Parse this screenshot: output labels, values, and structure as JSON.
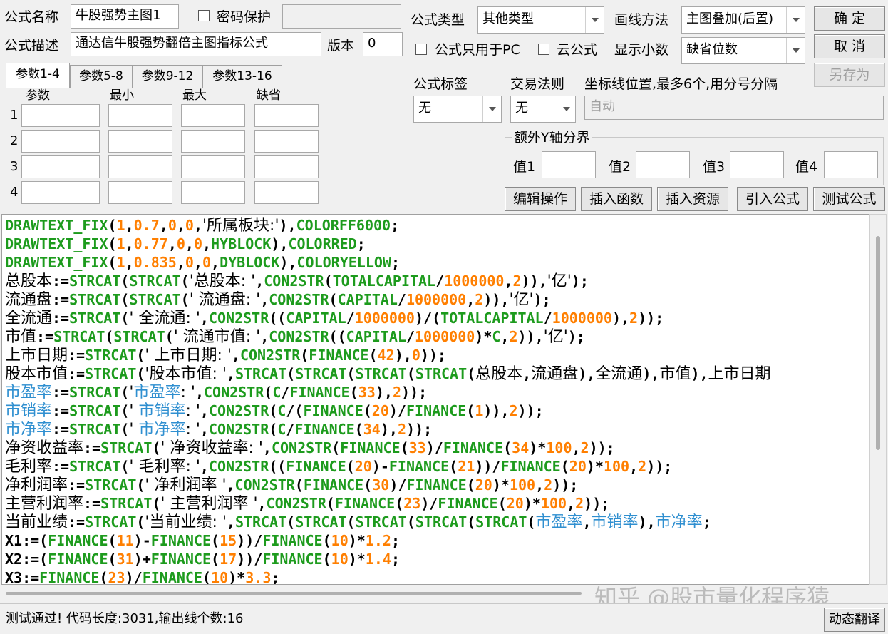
{
  "form": {
    "name_label": "公式名称",
    "name_value": "牛股强势主图1",
    "password_label": "密码保护",
    "desc_label": "公式描述",
    "desc_value": "通达信牛股强势翻倍主图指标公式",
    "version_label": "版本",
    "version_value": "0",
    "type_label": "公式类型",
    "type_value": "其他类型",
    "draw_label": "画线方法",
    "draw_value": "主图叠加(后置)",
    "pc_only_label": "公式只用于PC",
    "cloud_label": "云公式",
    "decimals_label": "显示小数",
    "decimals_value": "缺省位数",
    "tag_label": "公式标签",
    "tag_value": "无",
    "trade_label": "交易法则",
    "trade_value": "无",
    "axis_label": "坐标线位置,最多6个,用分号分隔",
    "axis_placeholder": "自动",
    "yaxis_group_label": "额外Y轴分界",
    "y1_label": "值1",
    "y2_label": "值2",
    "y3_label": "值3",
    "y4_label": "值4"
  },
  "buttons": {
    "ok": "确  定",
    "cancel": "取  消",
    "save_as": "另存为",
    "edit": "编辑操作",
    "insert_func": "插入函数",
    "insert_res": "插入资源",
    "import": "引入公式",
    "test": "测试公式",
    "translate": "动态翻译"
  },
  "params": {
    "tabs": [
      "参数1-4",
      "参数5-8",
      "参数9-12",
      "参数13-16"
    ],
    "headers": [
      "参数",
      "最小",
      "最大",
      "缺省"
    ],
    "rows": [
      "1",
      "2",
      "3",
      "4"
    ]
  },
  "code_lines": [
    [
      [
        "f",
        "DRAWTEXT_FIX"
      ],
      [
        "p",
        "("
      ],
      [
        "n",
        "1"
      ],
      [
        "p",
        ","
      ],
      [
        "n",
        "0.7"
      ],
      [
        "p",
        ","
      ],
      [
        "n",
        "0"
      ],
      [
        "p",
        ","
      ],
      [
        "n",
        "0"
      ],
      [
        "p",
        ","
      ],
      [
        "s",
        "'所属板块:'"
      ],
      [
        "p",
        "),"
      ],
      [
        "f",
        "COLORFF6000"
      ],
      [
        "p",
        ";"
      ]
    ],
    [
      [
        "f",
        "DRAWTEXT_FIX"
      ],
      [
        "p",
        "("
      ],
      [
        "n",
        "1"
      ],
      [
        "p",
        ","
      ],
      [
        "n",
        "0.77"
      ],
      [
        "p",
        ","
      ],
      [
        "n",
        "0"
      ],
      [
        "p",
        ","
      ],
      [
        "n",
        "0"
      ],
      [
        "p",
        ","
      ],
      [
        "f",
        "HYBLOCK"
      ],
      [
        "p",
        "),"
      ],
      [
        "f",
        "COLORRED"
      ],
      [
        "p",
        ";"
      ]
    ],
    [
      [
        "f",
        "DRAWTEXT_FIX"
      ],
      [
        "p",
        "("
      ],
      [
        "n",
        "1"
      ],
      [
        "p",
        ","
      ],
      [
        "n",
        "0.835"
      ],
      [
        "p",
        ","
      ],
      [
        "n",
        "0"
      ],
      [
        "p",
        ","
      ],
      [
        "n",
        "0"
      ],
      [
        "p",
        ","
      ],
      [
        "f",
        "DYBLOCK"
      ],
      [
        "p",
        "),"
      ],
      [
        "f",
        "COLORYELLOW"
      ],
      [
        "p",
        ";"
      ]
    ],
    [
      [
        "v",
        "总股本"
      ],
      [
        "p",
        ":="
      ],
      [
        "f",
        "STRCAT"
      ],
      [
        "p",
        "("
      ],
      [
        "f",
        "STRCAT"
      ],
      [
        "p",
        "("
      ],
      [
        "s",
        "'总股本: '"
      ],
      [
        "p",
        ","
      ],
      [
        "f",
        "CON2STR"
      ],
      [
        "p",
        "("
      ],
      [
        "f",
        "TOTALCAPITAL"
      ],
      [
        "p",
        "/"
      ],
      [
        "n",
        "1000000"
      ],
      [
        "p",
        ","
      ],
      [
        "n",
        "2"
      ],
      [
        "p",
        ")),"
      ],
      [
        "s",
        "'亿'"
      ],
      [
        "p",
        ");"
      ]
    ],
    [
      [
        "v",
        "流通盘"
      ],
      [
        "p",
        ":="
      ],
      [
        "f",
        "STRCAT"
      ],
      [
        "p",
        "("
      ],
      [
        "f",
        "STRCAT"
      ],
      [
        "p",
        "("
      ],
      [
        "s",
        "' 流通盘: '"
      ],
      [
        "p",
        ","
      ],
      [
        "f",
        "CON2STR"
      ],
      [
        "p",
        "("
      ],
      [
        "f",
        "CAPITAL"
      ],
      [
        "p",
        "/"
      ],
      [
        "n",
        "1000000"
      ],
      [
        "p",
        ","
      ],
      [
        "n",
        "2"
      ],
      [
        "p",
        ")),"
      ],
      [
        "s",
        "'亿'"
      ],
      [
        "p",
        ");"
      ]
    ],
    [
      [
        "v",
        "全流通"
      ],
      [
        "p",
        ":="
      ],
      [
        "f",
        "STRCAT"
      ],
      [
        "p",
        "("
      ],
      [
        "s",
        "' 全流通: '"
      ],
      [
        "p",
        ","
      ],
      [
        "f",
        "CON2STR"
      ],
      [
        "p",
        "(("
      ],
      [
        "f",
        "CAPITAL"
      ],
      [
        "p",
        "/"
      ],
      [
        "n",
        "1000000"
      ],
      [
        "p",
        ")/("
      ],
      [
        "f",
        "TOTALCAPITAL"
      ],
      [
        "p",
        "/"
      ],
      [
        "n",
        "1000000"
      ],
      [
        "p",
        "),"
      ],
      [
        "n",
        "2"
      ],
      [
        "p",
        "));"
      ]
    ],
    [
      [
        "v",
        "市值"
      ],
      [
        "p",
        ":="
      ],
      [
        "f",
        "STRCAT"
      ],
      [
        "p",
        "("
      ],
      [
        "f",
        "STRCAT"
      ],
      [
        "p",
        "("
      ],
      [
        "s",
        "' 流通市值: '"
      ],
      [
        "p",
        ","
      ],
      [
        "f",
        "CON2STR"
      ],
      [
        "p",
        "(("
      ],
      [
        "f",
        "CAPITAL"
      ],
      [
        "p",
        "/"
      ],
      [
        "n",
        "1000000"
      ],
      [
        "p",
        ")*"
      ],
      [
        "f",
        "C"
      ],
      [
        "p",
        ","
      ],
      [
        "n",
        "2"
      ],
      [
        "p",
        ")),"
      ],
      [
        "s",
        "'亿'"
      ],
      [
        "p",
        ");"
      ]
    ],
    [
      [
        "v",
        "上市日期"
      ],
      [
        "p",
        ":="
      ],
      [
        "f",
        "STRCAT"
      ],
      [
        "p",
        "("
      ],
      [
        "s",
        "' 上市日期: '"
      ],
      [
        "p",
        ","
      ],
      [
        "f",
        "CON2STR"
      ],
      [
        "p",
        "("
      ],
      [
        "f",
        "FINANCE"
      ],
      [
        "p",
        "("
      ],
      [
        "n",
        "42"
      ],
      [
        "p",
        "),"
      ],
      [
        "n",
        "0"
      ],
      [
        "p",
        "));"
      ]
    ],
    [
      [
        "v",
        "股本市值"
      ],
      [
        "p",
        ":="
      ],
      [
        "f",
        "STRCAT"
      ],
      [
        "p",
        "("
      ],
      [
        "s",
        "'股本市值: '"
      ],
      [
        "p",
        ","
      ],
      [
        "f",
        "STRCAT"
      ],
      [
        "p",
        "("
      ],
      [
        "f",
        "STRCAT"
      ],
      [
        "p",
        "("
      ],
      [
        "f",
        "STRCAT"
      ],
      [
        "p",
        "("
      ],
      [
        "f",
        "STRCAT"
      ],
      [
        "p",
        "("
      ],
      [
        "v",
        "总股本"
      ],
      [
        "p",
        ","
      ],
      [
        "v",
        "流通盘"
      ],
      [
        "p",
        "),"
      ],
      [
        "v",
        "全流通"
      ],
      [
        "p",
        "),"
      ],
      [
        "v",
        "市值"
      ],
      [
        "p",
        "),"
      ],
      [
        "v",
        "上市日期"
      ]
    ],
    [
      [
        "b",
        "市盈率"
      ],
      [
        "p",
        ":="
      ],
      [
        "f",
        "STRCAT"
      ],
      [
        "p",
        "("
      ],
      [
        "s",
        "'"
      ],
      [
        "b",
        "市盈率"
      ],
      [
        "s",
        ": '"
      ],
      [
        "p",
        ","
      ],
      [
        "f",
        "CON2STR"
      ],
      [
        "p",
        "("
      ],
      [
        "f",
        "C"
      ],
      [
        "p",
        "/"
      ],
      [
        "f",
        "FINANCE"
      ],
      [
        "p",
        "("
      ],
      [
        "n",
        "33"
      ],
      [
        "p",
        "),"
      ],
      [
        "n",
        "2"
      ],
      [
        "p",
        "));"
      ]
    ],
    [
      [
        "b",
        "市销率"
      ],
      [
        "p",
        ":="
      ],
      [
        "f",
        "STRCAT"
      ],
      [
        "p",
        "("
      ],
      [
        "s",
        "' "
      ],
      [
        "b",
        "市销率"
      ],
      [
        "s",
        ": '"
      ],
      [
        "p",
        ","
      ],
      [
        "f",
        "CON2STR"
      ],
      [
        "p",
        "("
      ],
      [
        "f",
        "C"
      ],
      [
        "p",
        "/("
      ],
      [
        "f",
        "FINANCE"
      ],
      [
        "p",
        "("
      ],
      [
        "n",
        "20"
      ],
      [
        "p",
        ")/"
      ],
      [
        "f",
        "FINANCE"
      ],
      [
        "p",
        "("
      ],
      [
        "n",
        "1"
      ],
      [
        "p",
        ")),"
      ],
      [
        "n",
        "2"
      ],
      [
        "p",
        "));"
      ]
    ],
    [
      [
        "b",
        "市净率"
      ],
      [
        "p",
        ":="
      ],
      [
        "f",
        "STRCAT"
      ],
      [
        "p",
        "("
      ],
      [
        "s",
        "' "
      ],
      [
        "b",
        "市净率"
      ],
      [
        "s",
        ": '"
      ],
      [
        "p",
        ","
      ],
      [
        "f",
        "CON2STR"
      ],
      [
        "p",
        "("
      ],
      [
        "f",
        "C"
      ],
      [
        "p",
        "/"
      ],
      [
        "f",
        "FINANCE"
      ],
      [
        "p",
        "("
      ],
      [
        "n",
        "34"
      ],
      [
        "p",
        "),"
      ],
      [
        "n",
        "2"
      ],
      [
        "p",
        "));"
      ]
    ],
    [
      [
        "v",
        "净资收益率"
      ],
      [
        "p",
        ":="
      ],
      [
        "f",
        "STRCAT"
      ],
      [
        "p",
        "("
      ],
      [
        "s",
        "' 净资收益率: '"
      ],
      [
        "p",
        ","
      ],
      [
        "f",
        "CON2STR"
      ],
      [
        "p",
        "("
      ],
      [
        "f",
        "FINANCE"
      ],
      [
        "p",
        "("
      ],
      [
        "n",
        "33"
      ],
      [
        "p",
        ")/"
      ],
      [
        "f",
        "FINANCE"
      ],
      [
        "p",
        "("
      ],
      [
        "n",
        "34"
      ],
      [
        "p",
        ")*"
      ],
      [
        "n",
        "100"
      ],
      [
        "p",
        ","
      ],
      [
        "n",
        "2"
      ],
      [
        "p",
        "));"
      ]
    ],
    [
      [
        "v",
        "毛利率"
      ],
      [
        "p",
        ":="
      ],
      [
        "f",
        "STRCAT"
      ],
      [
        "p",
        "("
      ],
      [
        "s",
        "' 毛利率: '"
      ],
      [
        "p",
        ","
      ],
      [
        "f",
        "CON2STR"
      ],
      [
        "p",
        "(("
      ],
      [
        "f",
        "FINANCE"
      ],
      [
        "p",
        "("
      ],
      [
        "n",
        "20"
      ],
      [
        "p",
        ")-"
      ],
      [
        "f",
        "FINANCE"
      ],
      [
        "p",
        "("
      ],
      [
        "n",
        "21"
      ],
      [
        "p",
        "))/"
      ],
      [
        "f",
        "FINANCE"
      ],
      [
        "p",
        "("
      ],
      [
        "n",
        "20"
      ],
      [
        "p",
        ")*"
      ],
      [
        "n",
        "100"
      ],
      [
        "p",
        ","
      ],
      [
        "n",
        "2"
      ],
      [
        "p",
        "));"
      ]
    ],
    [
      [
        "v",
        "净利润率"
      ],
      [
        "p",
        ":="
      ],
      [
        "f",
        "STRCAT"
      ],
      [
        "p",
        "("
      ],
      [
        "s",
        "' 净利润率 '"
      ],
      [
        "p",
        ","
      ],
      [
        "f",
        "CON2STR"
      ],
      [
        "p",
        "("
      ],
      [
        "f",
        "FINANCE"
      ],
      [
        "p",
        "("
      ],
      [
        "n",
        "30"
      ],
      [
        "p",
        ")/"
      ],
      [
        "f",
        "FINANCE"
      ],
      [
        "p",
        "("
      ],
      [
        "n",
        "20"
      ],
      [
        "p",
        ")*"
      ],
      [
        "n",
        "100"
      ],
      [
        "p",
        ","
      ],
      [
        "n",
        "2"
      ],
      [
        "p",
        "));"
      ]
    ],
    [
      [
        "v",
        "主营利润率"
      ],
      [
        "p",
        ":="
      ],
      [
        "f",
        "STRCAT"
      ],
      [
        "p",
        "("
      ],
      [
        "s",
        "' 主营利润率 '"
      ],
      [
        "p",
        ","
      ],
      [
        "f",
        "CON2STR"
      ],
      [
        "p",
        "("
      ],
      [
        "f",
        "FINANCE"
      ],
      [
        "p",
        "("
      ],
      [
        "n",
        "23"
      ],
      [
        "p",
        ")/"
      ],
      [
        "f",
        "FINANCE"
      ],
      [
        "p",
        "("
      ],
      [
        "n",
        "20"
      ],
      [
        "p",
        ")*"
      ],
      [
        "n",
        "100"
      ],
      [
        "p",
        ","
      ],
      [
        "n",
        "2"
      ],
      [
        "p",
        "));"
      ]
    ],
    [
      [
        "v",
        "当前业绩"
      ],
      [
        "p",
        ":="
      ],
      [
        "f",
        "STRCAT"
      ],
      [
        "p",
        "("
      ],
      [
        "s",
        "'当前业绩: '"
      ],
      [
        "p",
        ","
      ],
      [
        "f",
        "STRCAT"
      ],
      [
        "p",
        "("
      ],
      [
        "f",
        "STRCAT"
      ],
      [
        "p",
        "("
      ],
      [
        "f",
        "STRCAT"
      ],
      [
        "p",
        "("
      ],
      [
        "f",
        "STRCAT"
      ],
      [
        "p",
        "("
      ],
      [
        "f",
        "STRCAT"
      ],
      [
        "p",
        "("
      ],
      [
        "b",
        "市盈率"
      ],
      [
        "p",
        ","
      ],
      [
        "b",
        "市销率"
      ],
      [
        "p",
        "),"
      ],
      [
        "b",
        "市净率"
      ],
      [
        "p",
        ";"
      ]
    ],
    [
      [
        "p",
        "X1:=("
      ],
      [
        "f",
        "FINANCE"
      ],
      [
        "p",
        "("
      ],
      [
        "n",
        "11"
      ],
      [
        "p",
        ")-"
      ],
      [
        "f",
        "FINANCE"
      ],
      [
        "p",
        "("
      ],
      [
        "n",
        "15"
      ],
      [
        "p",
        "))/"
      ],
      [
        "f",
        "FINANCE"
      ],
      [
        "p",
        "("
      ],
      [
        "n",
        "10"
      ],
      [
        "p",
        ")*"
      ],
      [
        "n",
        "1.2"
      ],
      [
        "p",
        ";"
      ]
    ],
    [
      [
        "p",
        "X2:=("
      ],
      [
        "f",
        "FINANCE"
      ],
      [
        "p",
        "("
      ],
      [
        "n",
        "31"
      ],
      [
        "p",
        ")+"
      ],
      [
        "f",
        "FINANCE"
      ],
      [
        "p",
        "("
      ],
      [
        "n",
        "17"
      ],
      [
        "p",
        "))/"
      ],
      [
        "f",
        "FINANCE"
      ],
      [
        "p",
        "("
      ],
      [
        "n",
        "10"
      ],
      [
        "p",
        ")*"
      ],
      [
        "n",
        "1.4"
      ],
      [
        "p",
        ";"
      ]
    ],
    [
      [
        "p",
        "X3:="
      ],
      [
        "f",
        "FINANCE"
      ],
      [
        "p",
        "("
      ],
      [
        "n",
        "23"
      ],
      [
        "p",
        ")/"
      ],
      [
        "f",
        "FINANCE"
      ],
      [
        "p",
        "("
      ],
      [
        "n",
        "10"
      ],
      [
        "p",
        ")*"
      ],
      [
        "n",
        "3.3"
      ],
      [
        "p",
        ";"
      ]
    ]
  ],
  "status": {
    "text": "测试通过! 代码长度:3031,输出线个数:16"
  },
  "watermark": "知乎 @股市量化程序猿"
}
